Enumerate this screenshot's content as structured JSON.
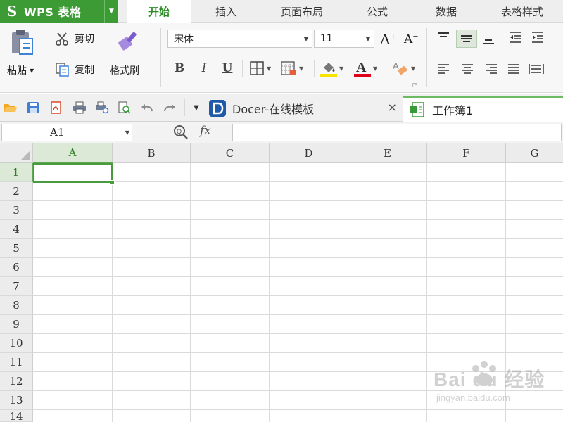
{
  "app": {
    "logo": "S",
    "title": "WPS 表格"
  },
  "tabs": [
    {
      "label": "开始",
      "active": true
    },
    {
      "label": "插入",
      "active": false
    },
    {
      "label": "页面布局",
      "active": false
    },
    {
      "label": "公式",
      "active": false
    },
    {
      "label": "数据",
      "active": false
    },
    {
      "label": "表格样式",
      "active": false
    }
  ],
  "ribbon": {
    "paste_label": "粘贴",
    "cut_label": "剪切",
    "copy_label": "复制",
    "format_painter_label": "格式刷",
    "font_name": "宋体",
    "font_size": "11",
    "bold": "B",
    "italic": "I",
    "underline": "U"
  },
  "doc_tabs": {
    "docer_label": "Docer-在线模板",
    "docer_close": "×",
    "workbook_label": "工作簿1"
  },
  "formula_bar": {
    "name_box": "A1",
    "fx": "fx",
    "formula": ""
  },
  "columns": [
    "A",
    "B",
    "C",
    "D",
    "E",
    "F",
    "G"
  ],
  "rows": [
    "1",
    "2",
    "3",
    "4",
    "5",
    "6",
    "7",
    "8",
    "9",
    "10",
    "11",
    "12",
    "13",
    "14"
  ],
  "selected_cell": "A1",
  "watermark": {
    "main": "Bai du 经验",
    "sub": "jingyan.baidu.com"
  },
  "colors": {
    "brand_green": "#3d9b35",
    "active_tab_text": "#2a8a22",
    "selection": "#4a9a3f"
  }
}
